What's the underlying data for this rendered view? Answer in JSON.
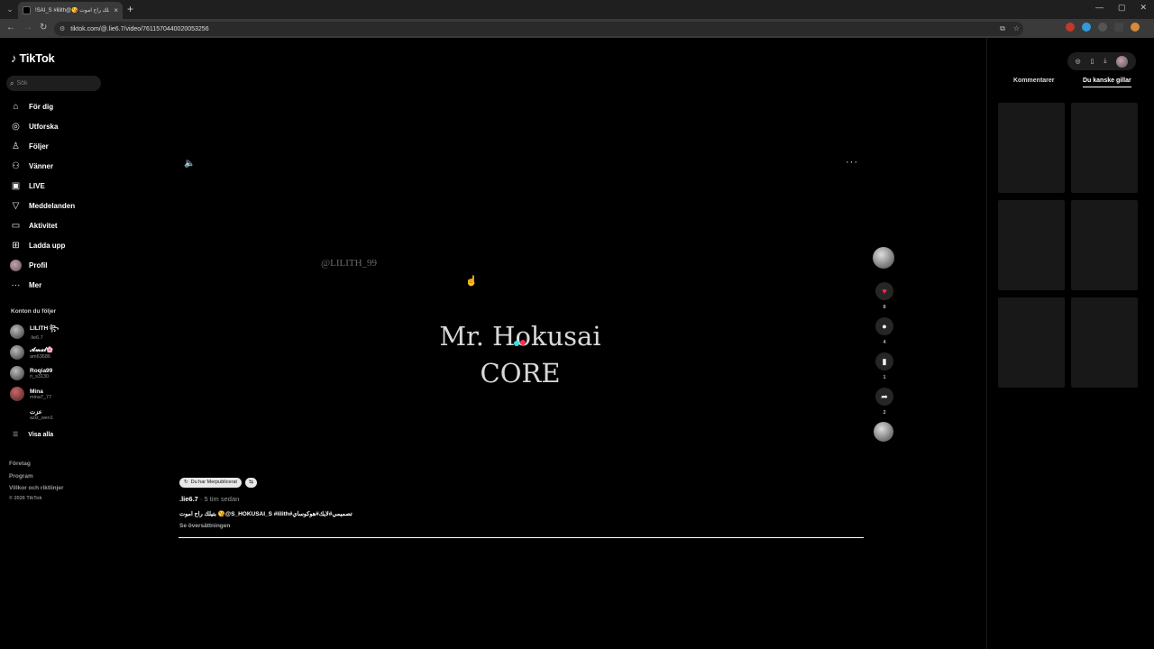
{
  "browser": {
    "tab_title": "!SAI_S #lilith@😘 بتيلك راح اموت",
    "tab_close": "×",
    "new_tab": "+",
    "url": "tiktok.com/@.lie6.7/video/7611570440020053256"
  },
  "sidebar": {
    "logo": "TikTok",
    "search_placeholder": "Sök",
    "nav": [
      {
        "label": "För dig",
        "icon": "home-icon"
      },
      {
        "label": "Utforska",
        "icon": "compass-icon"
      },
      {
        "label": "Följer",
        "icon": "following-icon"
      },
      {
        "label": "Vänner",
        "icon": "friends-icon"
      },
      {
        "label": "LIVE",
        "icon": "live-icon"
      },
      {
        "label": "Meddelanden",
        "icon": "messages-icon"
      },
      {
        "label": "Aktivitet",
        "icon": "activity-icon"
      },
      {
        "label": "Ladda upp",
        "icon": "upload-icon"
      },
      {
        "label": "Profil",
        "icon": "profile-avatar"
      },
      {
        "label": "Mer",
        "icon": "more-icon"
      }
    ],
    "following_heading": "Konton du följer",
    "accounts": [
      {
        "name": "LILITH ꧂",
        "username": ".lie6.7"
      },
      {
        "name": "𝓐𝓶𝓪𝓵🌸",
        "username": "am63686"
      },
      {
        "name": "Roqia99",
        "username": "ri_s3130"
      },
      {
        "name": "Mina",
        "username": "mina7_77"
      },
      {
        "name": "عزت",
        "username": "aziz_wen1"
      }
    ],
    "show_all": "Visa alla",
    "footer_links": [
      "Företag",
      "Program",
      "Villkor och riktlinjer"
    ],
    "copyright": "© 2026 TikTok"
  },
  "video": {
    "watermark": "@LILITH_99",
    "title_line1": "Mr. Hokusai",
    "title_line2": "CORE",
    "progress": 1.0
  },
  "rail": {
    "like_count": "8",
    "comment_count": "4",
    "save_count": "1",
    "share_count": "2"
  },
  "caption": {
    "badge": "Du har Merpublicerat",
    "author": ".lie6.7",
    "time": " · 5 tim sedan",
    "text": "بتيلك راح اموت 😘@S_HOKUSAI_S #lilith#تصميمي#لايك#هوكوساي",
    "translate": "Se översättningen"
  },
  "right_panel": {
    "tabs": [
      "Kommentarer",
      "Du kanske gillar"
    ],
    "active_tab": "Du kanske gillar"
  },
  "colors": {
    "accent": "#fe2c55",
    "background": "#000000"
  }
}
